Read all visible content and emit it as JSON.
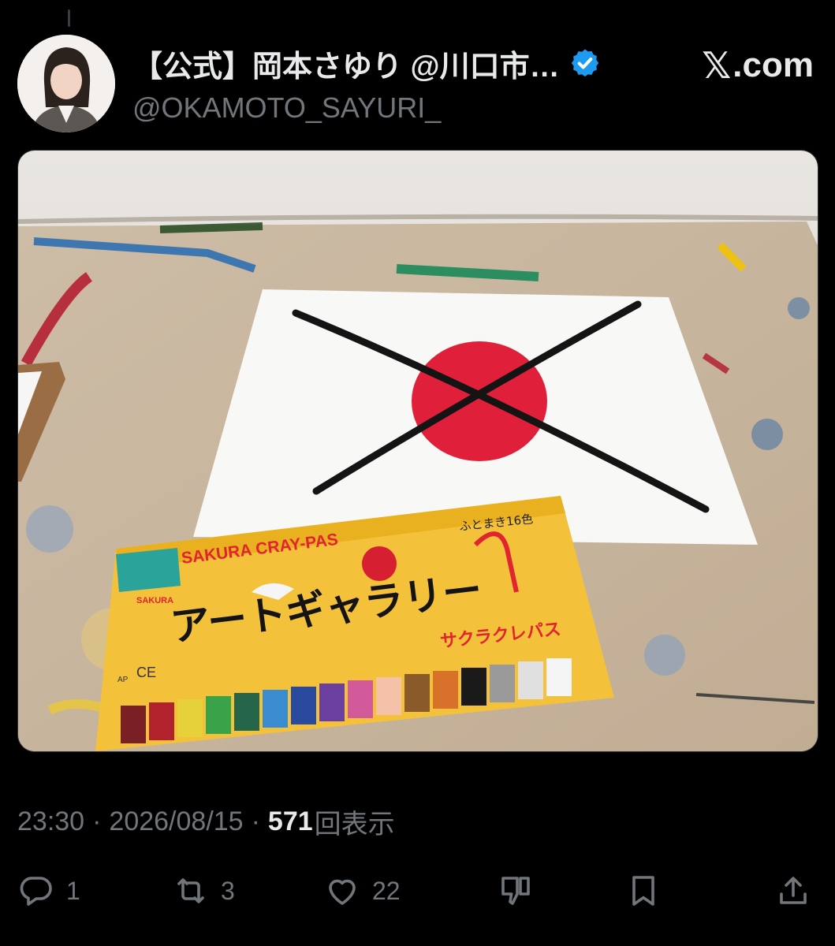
{
  "author": {
    "display_name": "【公式】岡本さゆり @川口市…",
    "handle": "@OKAMOTO_SAYURI_",
    "verified": true
  },
  "brand": {
    "x_glyph": "𝕏",
    "text": ".com"
  },
  "media": {
    "box": {
      "brand": "SAKURA CRAY-PAS",
      "logo_text": "SAKURA",
      "size_note": "ふとまき16色",
      "title_ja": "アートギャラリー",
      "subtitle_ja": "サクラクレパス",
      "ce_mark": "CE",
      "ap_mark": "AP"
    }
  },
  "meta": {
    "time": "23:30",
    "separator": "·",
    "date": "2026/08/15",
    "views_count": "571",
    "views_label": "回表示"
  },
  "actions": {
    "replies": "1",
    "reposts": "3",
    "likes": "22"
  },
  "colors": {
    "background": "#000000",
    "primary_text": "#e7e9ea",
    "secondary_text": "#71767b",
    "verified_blue": "#1d9bf0"
  }
}
